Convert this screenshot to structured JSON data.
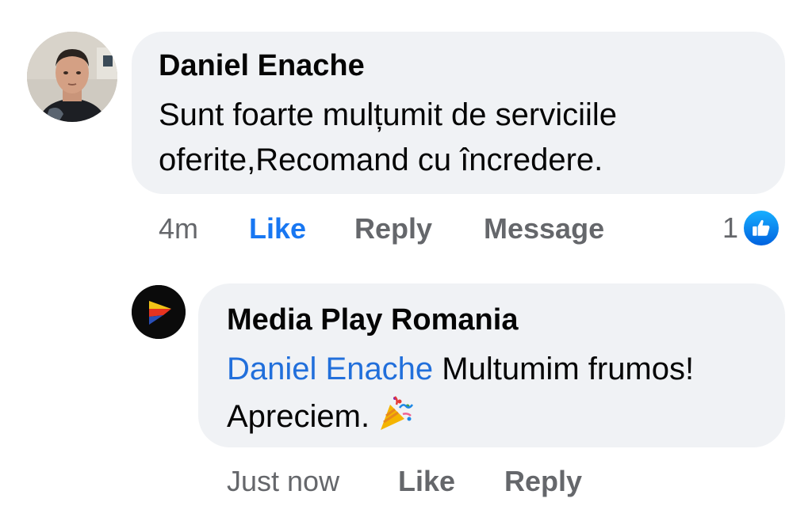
{
  "comment": {
    "author": "Daniel Enache",
    "text": "Sunt foarte mulțumit de serviciile oferite,Recomand cu încredere.",
    "avatar_icon": "profile-photo",
    "actions": {
      "time": "4m",
      "like": "Like",
      "reply": "Reply",
      "message": "Message"
    },
    "reaction_count": "1",
    "reaction_icon": "like-thumb-icon",
    "like_active_color": "#1877f2"
  },
  "reply": {
    "author": "Media Play Romania",
    "mention": "Daniel Enache",
    "text": " Multumim frumos! Apreciem.",
    "emoji_icon": "party-popper-icon",
    "avatar_icon": "media-play-logo",
    "actions": {
      "time": "Just now",
      "like": "Like",
      "reply": "Reply"
    }
  },
  "colors": {
    "bubble": "#f0f2f5",
    "text": "#050505",
    "secondary": "#65676b",
    "mention": "#216fdb"
  }
}
